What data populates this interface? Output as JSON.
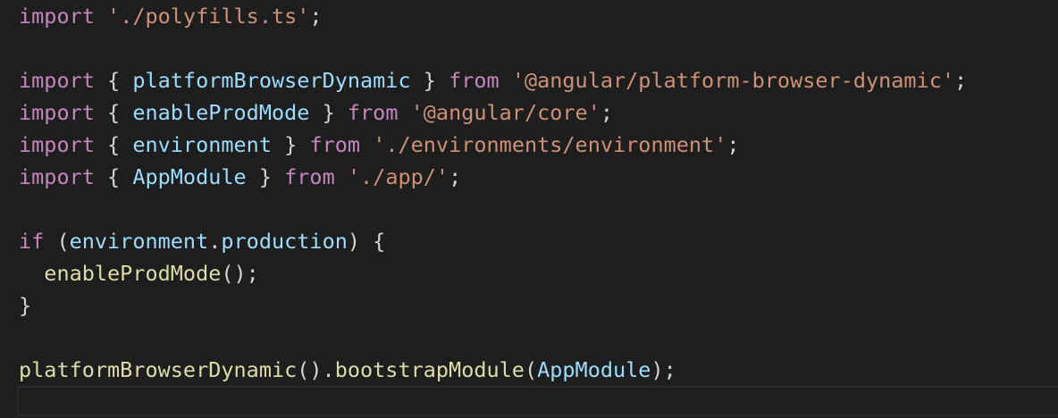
{
  "editor": {
    "lines": [
      [
        {
          "t": "import",
          "c": "kw-import"
        },
        {
          "t": " ",
          "c": "punc"
        },
        {
          "t": "'./polyfills.ts'",
          "c": "str"
        },
        {
          "t": ";",
          "c": "punc"
        }
      ],
      [],
      [
        {
          "t": "import",
          "c": "kw-import"
        },
        {
          "t": " { ",
          "c": "punc"
        },
        {
          "t": "platformBrowserDynamic",
          "c": "var"
        },
        {
          "t": " } ",
          "c": "punc"
        },
        {
          "t": "from",
          "c": "kw-import"
        },
        {
          "t": " ",
          "c": "punc"
        },
        {
          "t": "'@angular/platform-browser-dynamic'",
          "c": "str"
        },
        {
          "t": ";",
          "c": "punc"
        }
      ],
      [
        {
          "t": "import",
          "c": "kw-import"
        },
        {
          "t": " { ",
          "c": "punc"
        },
        {
          "t": "enableProdMode",
          "c": "var"
        },
        {
          "t": " } ",
          "c": "punc"
        },
        {
          "t": "from",
          "c": "kw-import"
        },
        {
          "t": " ",
          "c": "punc"
        },
        {
          "t": "'@angular/core'",
          "c": "str"
        },
        {
          "t": ";",
          "c": "punc"
        }
      ],
      [
        {
          "t": "import",
          "c": "kw-import"
        },
        {
          "t": " { ",
          "c": "punc"
        },
        {
          "t": "environment",
          "c": "var"
        },
        {
          "t": " } ",
          "c": "punc"
        },
        {
          "t": "from",
          "c": "kw-import"
        },
        {
          "t": " ",
          "c": "punc"
        },
        {
          "t": "'./environments/environment'",
          "c": "str"
        },
        {
          "t": ";",
          "c": "punc"
        }
      ],
      [
        {
          "t": "import",
          "c": "kw-import"
        },
        {
          "t": " { ",
          "c": "punc"
        },
        {
          "t": "AppModule",
          "c": "var"
        },
        {
          "t": " } ",
          "c": "punc"
        },
        {
          "t": "from",
          "c": "kw-import"
        },
        {
          "t": " ",
          "c": "punc"
        },
        {
          "t": "'./app/'",
          "c": "str"
        },
        {
          "t": ";",
          "c": "punc"
        }
      ],
      [],
      [
        {
          "t": "if",
          "c": "kw-if"
        },
        {
          "t": " (",
          "c": "punc"
        },
        {
          "t": "environment",
          "c": "var"
        },
        {
          "t": ".",
          "c": "punc"
        },
        {
          "t": "production",
          "c": "var"
        },
        {
          "t": ") {",
          "c": "punc"
        }
      ],
      [
        {
          "t": "  ",
          "c": "punc"
        },
        {
          "t": "enableProdMode",
          "c": "fn"
        },
        {
          "t": "();",
          "c": "punc"
        }
      ],
      [
        {
          "t": "}",
          "c": "punc"
        }
      ],
      [],
      [
        {
          "t": "platformBrowserDynamic",
          "c": "fn"
        },
        {
          "t": "().",
          "c": "punc"
        },
        {
          "t": "bootstrapModule",
          "c": "fn"
        },
        {
          "t": "(",
          "c": "punc"
        },
        {
          "t": "AppModule",
          "c": "var"
        },
        {
          "t": ");",
          "c": "punc"
        }
      ],
      []
    ]
  },
  "colors": {
    "background": "#1e1e1e",
    "keyword": "#c586c0",
    "string": "#ce9178",
    "variable": "#9cdcfe",
    "function": "#dcdcaa",
    "punctuation": "#d4d4d4"
  }
}
